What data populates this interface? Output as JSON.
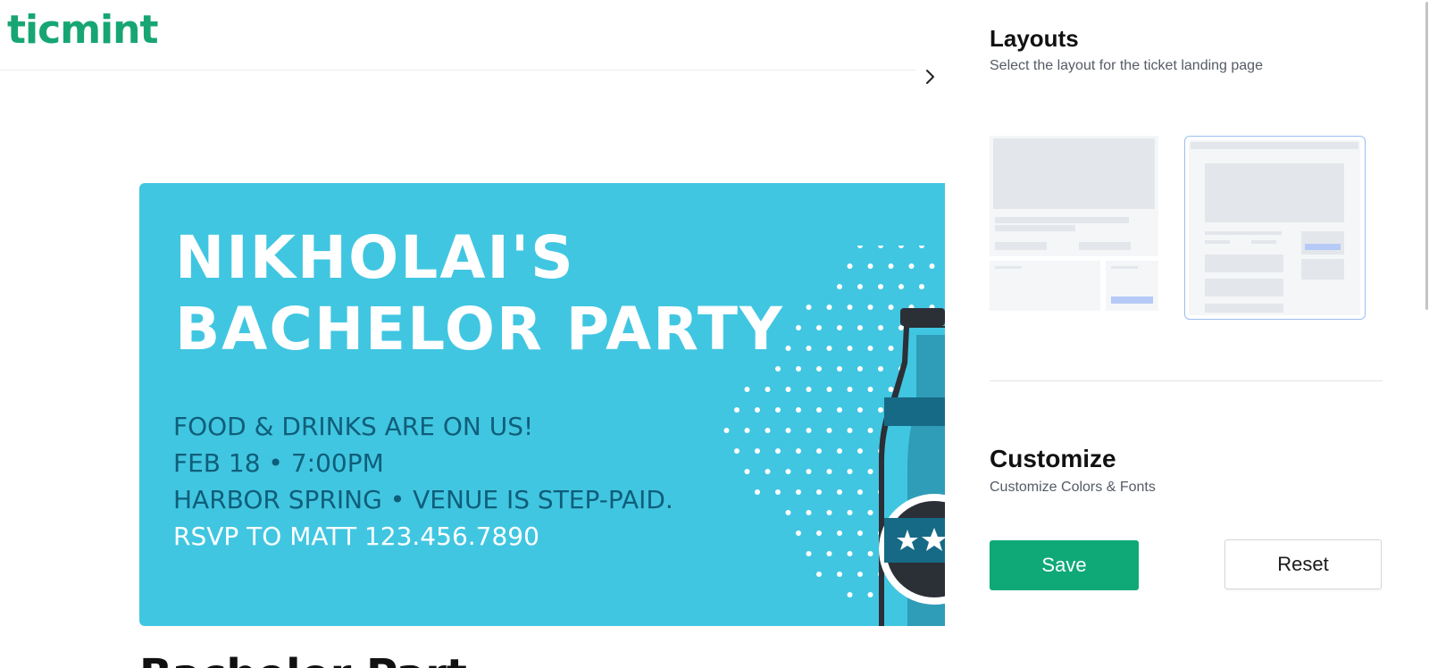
{
  "app": {
    "brand": "ticmint"
  },
  "preview": {
    "banner_title_lines": [
      "NIKHOLAI'S",
      "BACHELOR PARTY"
    ],
    "banner_detail_lines": [
      "FOOD & DRINKS ARE ON US!",
      "FEB 18 • 7:00PM",
      "HARBOR SPRING • VENUE IS STEP-PAID.",
      "RSVP TO MATT 123.456.7890"
    ],
    "heading_partial": "Bachelor Part",
    "colors": {
      "banner": "#41c6e1",
      "dark_text": "#0f5e7a",
      "light_text": "#ffffff"
    }
  },
  "panel": {
    "layouts_title": "Layouts",
    "layouts_subtitle": "Select the layout for the ticket landing page",
    "layout_options": [
      {
        "name": "layout-option-1",
        "selected": false
      },
      {
        "name": "layout-option-2",
        "selected": true
      }
    ],
    "customize_title": "Customize",
    "customize_subtitle": "Customize Colors & Fonts",
    "save_label": "Save",
    "reset_label": "Reset",
    "colors": {
      "save": "#0fa978",
      "selected_border": "#9cbdf2",
      "skeleton_accent": "#b6caf7"
    }
  },
  "icons": {
    "collapse": "chevron-right-icon"
  }
}
